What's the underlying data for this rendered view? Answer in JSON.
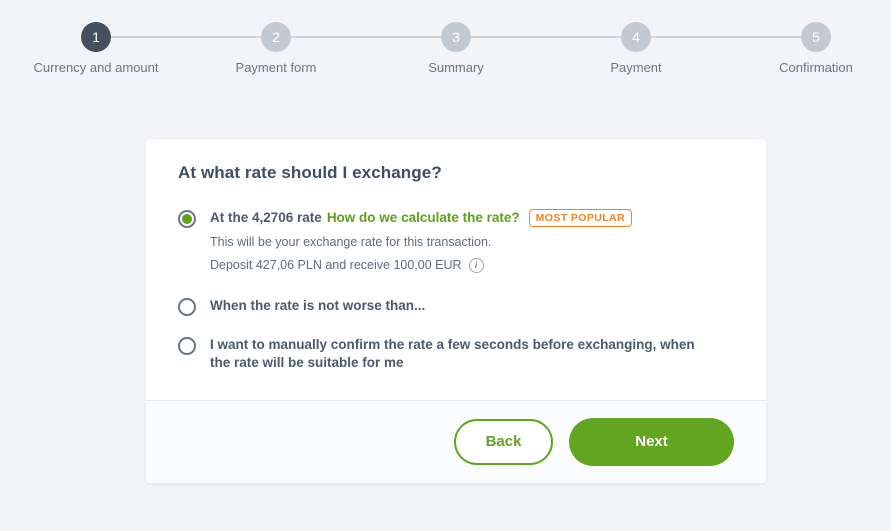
{
  "stepper": {
    "steps": [
      {
        "number": "1",
        "label": "Currency and amount",
        "active": true
      },
      {
        "number": "2",
        "label": "Payment form",
        "active": false
      },
      {
        "number": "3",
        "label": "Summary",
        "active": false
      },
      {
        "number": "4",
        "label": "Payment",
        "active": false
      },
      {
        "number": "5",
        "label": "Confirmation",
        "active": false
      }
    ]
  },
  "card": {
    "title": "At what rate should I exchange?",
    "options": [
      {
        "selected": true,
        "lead": "At the 4,2706 rate",
        "link": "How do we calculate the rate?",
        "badge": "MOST POPULAR",
        "sub1": "This will be your exchange rate for this transaction.",
        "sub2": "Deposit 427,06 PLN and receive 100,00 EUR",
        "info_icon": "info-icon"
      },
      {
        "selected": false,
        "lead": "When the rate is not worse than..."
      },
      {
        "selected": false,
        "lead": "I want to manually confirm the rate a few seconds before exchanging, when the rate will be suitable for me"
      }
    ],
    "footer": {
      "back_label": "Back",
      "next_label": "Next"
    }
  },
  "colors": {
    "page_background": "#f2f4f7",
    "active_step": "#454f5e",
    "inactive_step": "#c3c9d2",
    "green": "#63a421",
    "link_green": "#5da019",
    "orange": "#f5821f",
    "title": "#3d4f66"
  }
}
